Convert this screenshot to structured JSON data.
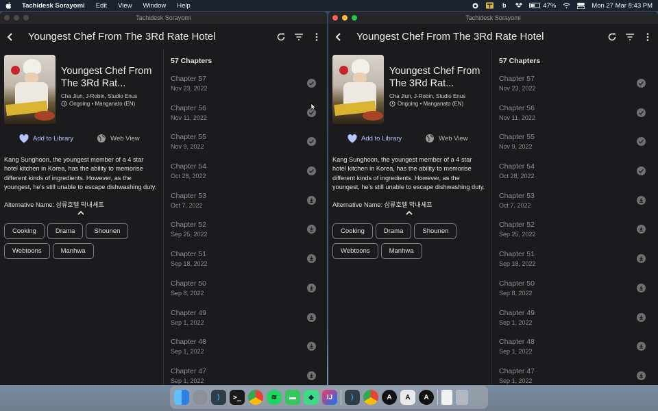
{
  "menubar": {
    "app_name": "Tachidesk Sorayomi",
    "menus": [
      "Edit",
      "View",
      "Window",
      "Help"
    ],
    "battery": "47%",
    "datetime": "Mon 27 Mar  8:43 PM"
  },
  "window_title": "Tachidesk Sorayomi",
  "manga": {
    "title": "Youngest Chef From The 3Rd Rate Hotel",
    "short_title": "Youngest Chef From The 3Rd Rat...",
    "authors": "Cha Jiun, J-Robin, Studio Enus",
    "status": "Ongoing • Manganato (EN)",
    "add_library": "Add to Library",
    "web_view": "Web View",
    "description": "Kang Sunghoon, the youngest member of a 4 star hotel kitchen in Korea, has the ability to memorise different kinds of ingredients. However, as the youngest, he's still unable to escape dishwashing duty.",
    "alt_name": "Alternative Name: 삼류호텔 막내셰프",
    "genres": [
      "Cooking",
      "Drama",
      "Shounen",
      "Webtoons",
      "Manhwa"
    ]
  },
  "chapter_count": "57 Chapters",
  "chapters": [
    {
      "name": "Chapter 57",
      "date": "Nov 23, 2022",
      "state": "read"
    },
    {
      "name": "Chapter 56",
      "date": "Nov 11, 2022",
      "state": "read"
    },
    {
      "name": "Chapter 55",
      "date": "Nov 9, 2022",
      "state": "read"
    },
    {
      "name": "Chapter 54",
      "date": "Oct 28, 2022",
      "state": "read"
    },
    {
      "name": "Chapter 53",
      "date": "Oct 7, 2022",
      "state": "download"
    },
    {
      "name": "Chapter 52",
      "date": "Sep 25, 2022",
      "state": "download"
    },
    {
      "name": "Chapter 51",
      "date": "Sep 18, 2022",
      "state": "download"
    },
    {
      "name": "Chapter 50",
      "date": "Sep 8, 2022",
      "state": "download"
    },
    {
      "name": "Chapter 49",
      "date": "Sep 1, 2022",
      "state": "download"
    },
    {
      "name": "Chapter 48",
      "date": "Sep 1, 2022",
      "state": "download"
    },
    {
      "name": "Chapter 47",
      "date": "Sep 1, 2022",
      "state": "download"
    }
  ],
  "icons": {
    "back": "arrow-back-icon",
    "refresh": "refresh-icon",
    "filter": "filter-icon",
    "more": "more-vert-icon",
    "heart": "heart-icon",
    "globe": "globe-icon",
    "clock": "clock-icon",
    "read": "check-circle-icon",
    "download": "download-circle-icon"
  },
  "colors": {
    "accent": "#b8c6ff",
    "background": "#1b1b1d"
  }
}
